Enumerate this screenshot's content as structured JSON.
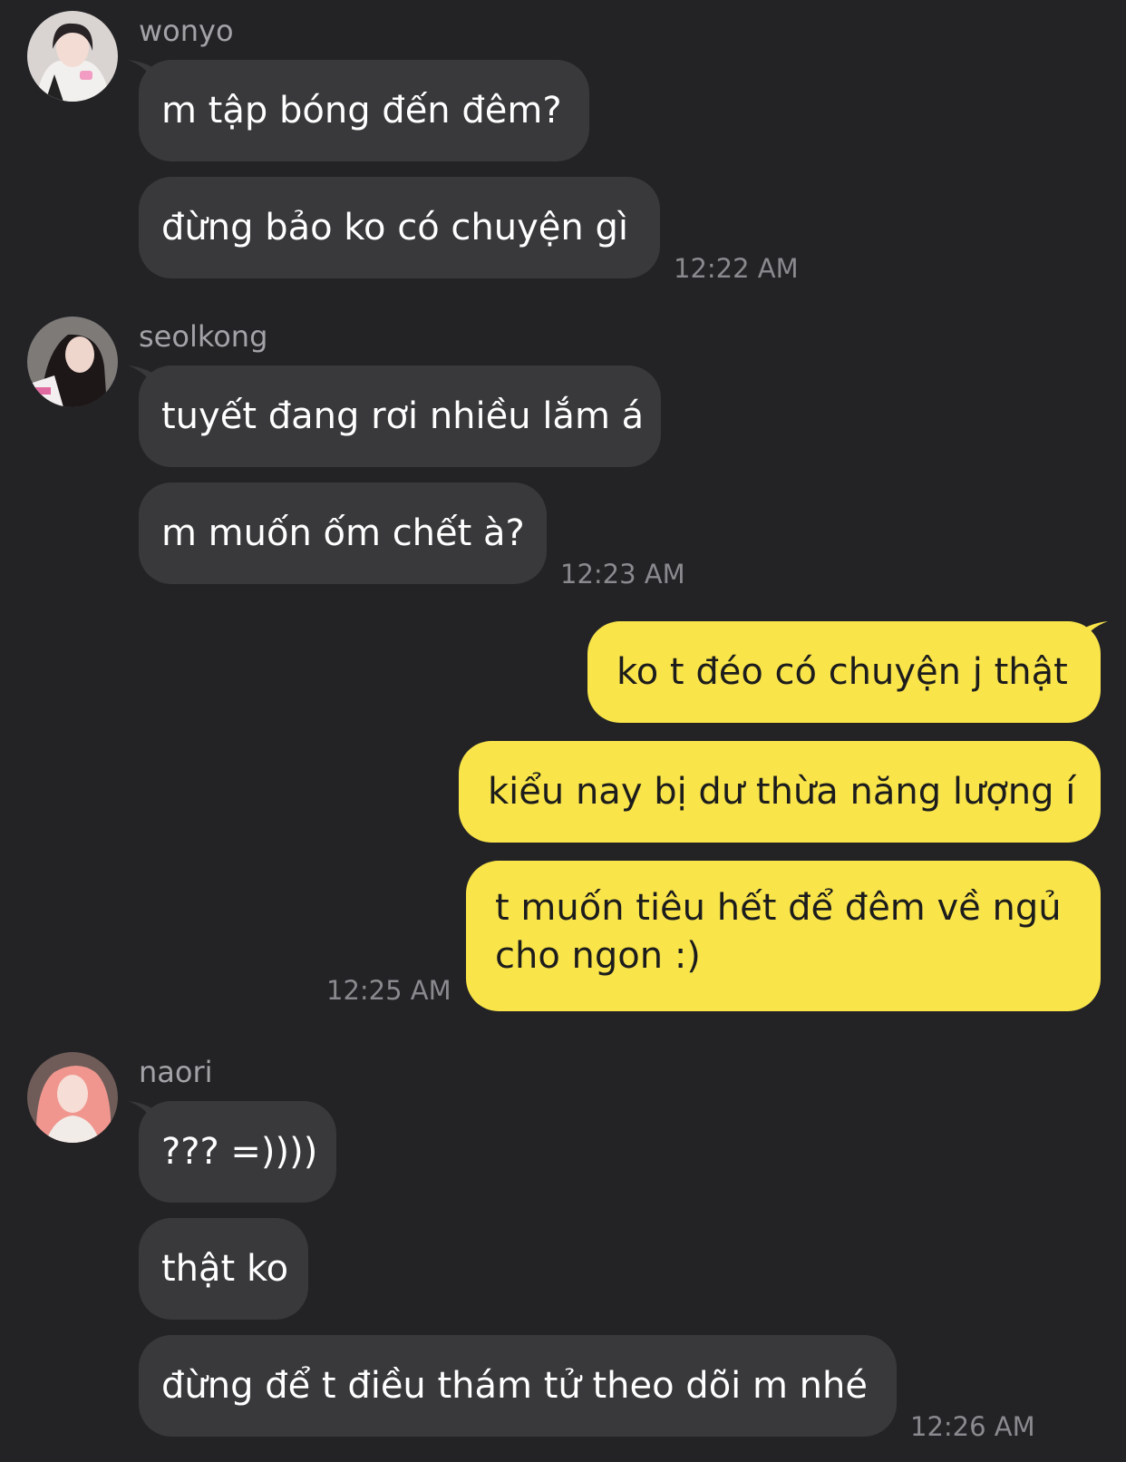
{
  "colors": {
    "background": "#232326",
    "incoming_bubble": "#39393c",
    "outgoing_bubble": "#f9e44a",
    "sender_name": "#a3a3a7",
    "timestamp": "#8a8a8e"
  },
  "groups": [
    {
      "sender": "wonyo",
      "avatar_icon": "profile-photo-avatar",
      "messages": [
        "m tập bóng đến đêm?",
        "đừng bảo ko có chuyện gì"
      ],
      "time": "12:22 AM"
    },
    {
      "sender": "seolkong",
      "avatar_icon": "profile-photo-avatar",
      "messages": [
        "tuyết đang rơi nhiều lắm á",
        "m muốn ốm chết à?"
      ],
      "time": "12:23 AM"
    },
    {
      "sender": "me",
      "messages": [
        "ko t đéo có chuyện j thật",
        "kiểu nay bị dư thừa năng lượng í",
        "t muốn tiêu hết để đêm về ngủ cho ngon :)"
      ],
      "time": "12:25 AM"
    },
    {
      "sender": "naori",
      "avatar_icon": "profile-photo-avatar",
      "messages": [
        "??? =))))",
        "thật ko",
        "đừng để t điều thám tử theo dõi m nhé"
      ],
      "time": "12:26 AM"
    }
  ]
}
